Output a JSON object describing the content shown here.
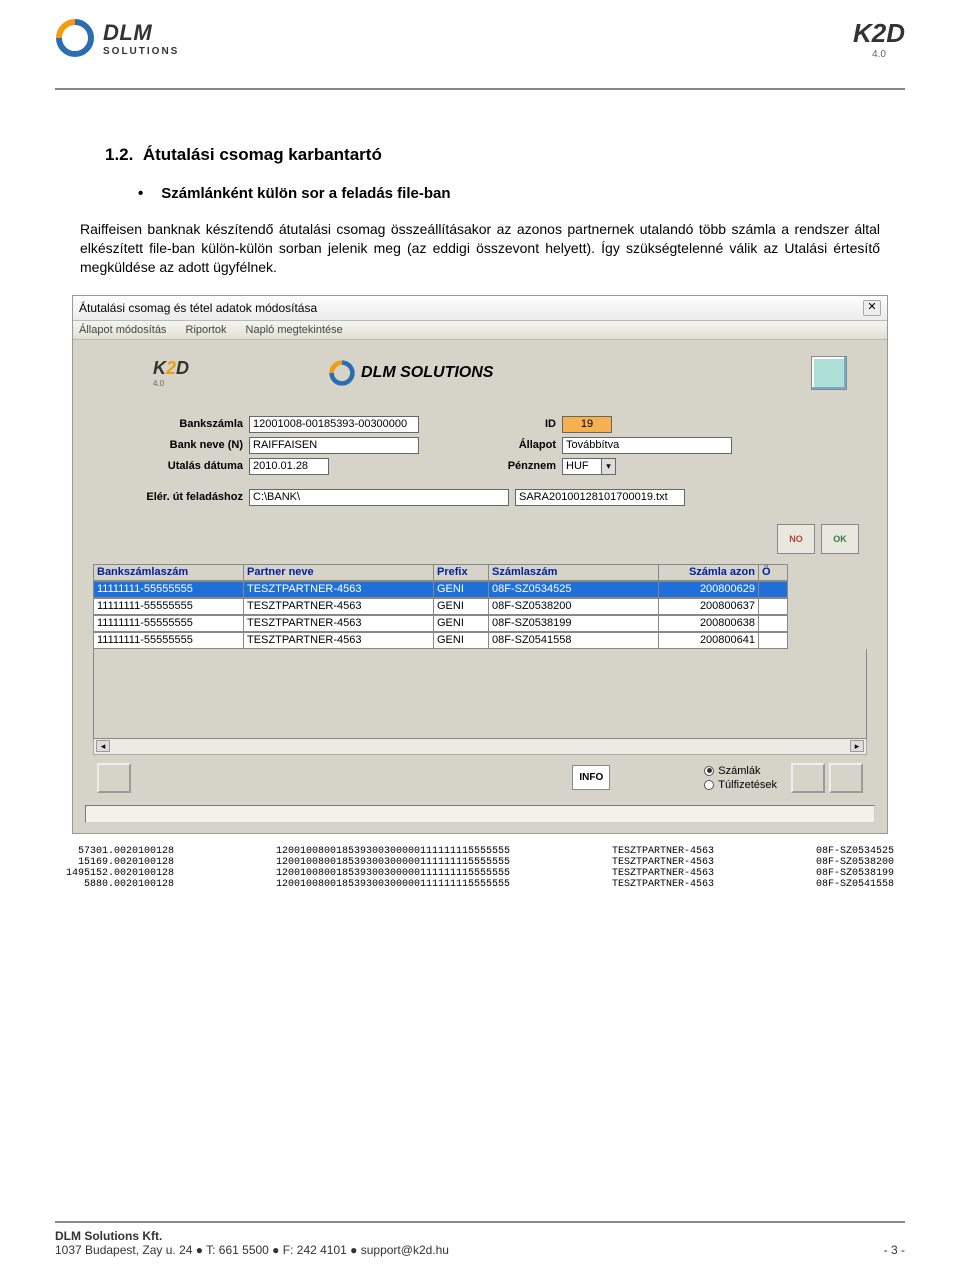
{
  "header": {
    "dlm_name": "DLM",
    "dlm_sub": "SOLUTIONS",
    "k2d_name": "K2D",
    "k2d_ver": "4.0"
  },
  "section": {
    "number": "1.2.",
    "title": "Átutalási csomag karbantartó",
    "bullet": "Számlánként külön sor a feladás file-ban",
    "paragraph": "Raiffeisen banknak készítendő átutalási csomag összeállításakor az azonos partnernek utalandó több számla a rendszer által elkészített file-ban külön-külön sorban jelenik meg (az eddigi összevont helyett). Így szükségtelenné válik az Utalási értesítő megküldése az adott ügyfélnek."
  },
  "app": {
    "title": "Átutalási csomag és tétel adatok módosítása",
    "menu": {
      "m1": "Állapot módosítás",
      "m2": "Riportok",
      "m3": "Napló megtekintése"
    },
    "logos": {
      "k2d": "K2D",
      "k2d_ver": "4.0",
      "dlm": "DLM SOLUTIONS"
    },
    "form": {
      "bankszamla_lbl": "Bankszámla",
      "bankszamla": "12001008-00185393-00300000",
      "id_lbl": "ID",
      "id": "19",
      "banknev_lbl": "Bank neve (N)",
      "banknev": "RAIFFAISEN",
      "allapot_lbl": "Állapot",
      "allapot": "Továbbítva",
      "utalas_lbl": "Utalás dátuma",
      "utalas": "2010.01.28",
      "penznem_lbl": "Pénznem",
      "penznem": "HUF",
      "path_lbl": "Elér. út feladáshoz",
      "path": "C:\\BANK\\",
      "filename": "SARA20100128101700019.txt"
    },
    "buttons": {
      "no": "NO",
      "ok": "OK",
      "info": "INFO"
    },
    "table": {
      "headers": {
        "c1": "Bankszámlaszám",
        "c2": "Partner neve",
        "c3": "Prefix",
        "c4": "Számlaszám",
        "c5": "Számla azon",
        "c6": "Ö"
      },
      "rows": [
        {
          "c1": "11111111-55555555",
          "c2": "TESZTPARTNER-4563",
          "c3": "GENI",
          "c4": "08F-SZ0534525",
          "c5": "200800629",
          "c6": ""
        },
        {
          "c1": "11111111-55555555",
          "c2": "TESZTPARTNER-4563",
          "c3": "GENI",
          "c4": "08F-SZ0538200",
          "c5": "200800637",
          "c6": ""
        },
        {
          "c1": "11111111-55555555",
          "c2": "TESZTPARTNER-4563",
          "c3": "GENI",
          "c4": "08F-SZ0538199",
          "c5": "200800638",
          "c6": ""
        },
        {
          "c1": "11111111-55555555",
          "c2": "TESZTPARTNER-4563",
          "c3": "GENI",
          "c4": "08F-SZ0541558",
          "c5": "200800641",
          "c6": ""
        }
      ]
    },
    "radios": {
      "r1": "Számlák",
      "r2": "Túlfizetések"
    }
  },
  "raw": {
    "col1": "  57301.0020100128\n  15169.0020100128\n1495152.0020100128\n   5880.0020100128",
    "col2": "120010080018539300300000111111115555555\n120010080018539300300000111111115555555\n120010080018539300300000111111115555555\n120010080018539300300000111111115555555",
    "col3": "TESZTPARTNER-4563\nTESZTPARTNER-4563\nTESZTPARTNER-4563\nTESZTPARTNER-4563",
    "col4": "08F-SZ0534525\n08F-SZ0538200\n08F-SZ0538199\n08F-SZ0541558"
  },
  "footer": {
    "company": "DLM Solutions Kft.",
    "address": "1037 Budapest, Zay u. 24  ●  T: 661 5500  ●  F: 242 4101  ●  support@k2d.hu",
    "page": "- 3 -"
  }
}
